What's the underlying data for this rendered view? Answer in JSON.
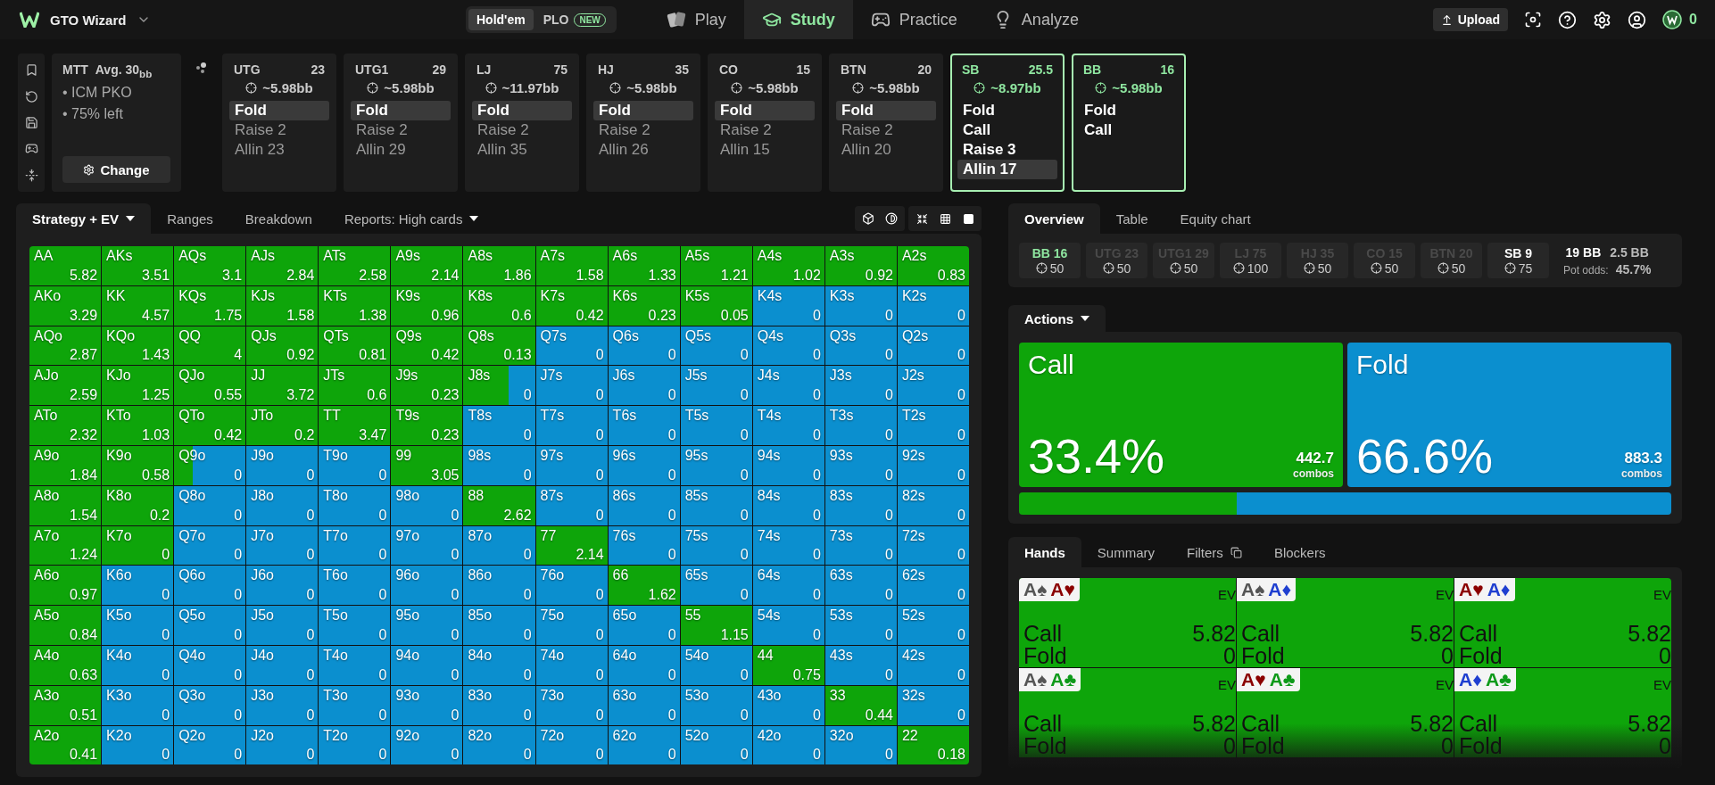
{
  "app": {
    "name": "GTO Wizard"
  },
  "modes": [
    {
      "label": "Hold'em",
      "selected": true
    },
    {
      "label": "PLO",
      "selected": false,
      "badge": "NEW"
    }
  ],
  "nav": [
    {
      "label": "Play",
      "selected": false
    },
    {
      "label": "Study",
      "selected": true
    },
    {
      "label": "Practice",
      "selected": false
    },
    {
      "label": "Analyze",
      "selected": false
    }
  ],
  "upload": {
    "label": "Upload"
  },
  "coins": "0",
  "spot": {
    "format": "MTT",
    "stack": "Avg. 30$_{bb}$",
    "details": [
      "• ICM PKO",
      "• 75% left"
    ],
    "button": "Change"
  },
  "positions": [
    {
      "name": "UTG",
      "stack": "23",
      "to_call": "~5.98bb",
      "active": false,
      "actions": [
        {
          "label": "Fold",
          "selected": true
        },
        {
          "label": "Raise 2",
          "selected": false
        },
        {
          "label": "Allin 23",
          "selected": false
        }
      ]
    },
    {
      "name": "UTG1",
      "stack": "29",
      "to_call": "~5.98bb",
      "active": false,
      "actions": [
        {
          "label": "Fold",
          "selected": true
        },
        {
          "label": "Raise 2",
          "selected": false
        },
        {
          "label": "Allin 29",
          "selected": false
        }
      ]
    },
    {
      "name": "LJ",
      "stack": "75",
      "to_call": "~11.97bb",
      "active": false,
      "actions": [
        {
          "label": "Fold",
          "selected": true
        },
        {
          "label": "Raise 2",
          "selected": false
        },
        {
          "label": "Allin 35",
          "selected": false
        }
      ]
    },
    {
      "name": "HJ",
      "stack": "35",
      "to_call": "~5.98bb",
      "active": false,
      "actions": [
        {
          "label": "Fold",
          "selected": true
        },
        {
          "label": "Raise 2",
          "selected": false
        },
        {
          "label": "Allin 26",
          "selected": false
        }
      ]
    },
    {
      "name": "CO",
      "stack": "15",
      "to_call": "~5.98bb",
      "active": false,
      "actions": [
        {
          "label": "Fold",
          "selected": true
        },
        {
          "label": "Raise 2",
          "selected": false
        },
        {
          "label": "Allin 15",
          "selected": false
        }
      ]
    },
    {
      "name": "BTN",
      "stack": "20",
      "to_call": "~5.98bb",
      "active": false,
      "actions": [
        {
          "label": "Fold",
          "selected": true
        },
        {
          "label": "Raise 2",
          "selected": false
        },
        {
          "label": "Allin 20",
          "selected": false
        }
      ]
    },
    {
      "name": "SB",
      "stack": "25.5",
      "to_call": "~8.97bb",
      "active": true,
      "actions": [
        {
          "label": "Fold",
          "selected": false
        },
        {
          "label": "Call",
          "selected": false
        },
        {
          "label": "Raise 3",
          "selected": false
        },
        {
          "label": "Allin 17",
          "selected": true
        }
      ]
    },
    {
      "name": "BB",
      "stack": "16",
      "to_call": "~5.98bb",
      "active": true,
      "actions": [
        {
          "label": "Fold",
          "selected": false
        },
        {
          "label": "Call",
          "selected": false
        }
      ]
    }
  ],
  "matrix_tabs": [
    {
      "label": "Strategy + EV",
      "selected": true,
      "dropdown": true
    },
    {
      "label": "Ranges",
      "selected": false,
      "dropdown": false
    },
    {
      "label": "Breakdown",
      "selected": false,
      "dropdown": false
    },
    {
      "label": "Reports: High cards",
      "selected": false,
      "dropdown": true
    }
  ],
  "matrix": [
    [
      {
        "hand": "AA",
        "ev": "5.82",
        "kind": "call"
      },
      {
        "hand": "AKs",
        "ev": "3.51",
        "kind": "call"
      },
      {
        "hand": "AQs",
        "ev": "3.1",
        "kind": "call"
      },
      {
        "hand": "AJs",
        "ev": "2.84",
        "kind": "call"
      },
      {
        "hand": "ATs",
        "ev": "2.58",
        "kind": "call"
      },
      {
        "hand": "A9s",
        "ev": "2.14",
        "kind": "call"
      },
      {
        "hand": "A8s",
        "ev": "1.86",
        "kind": "call"
      },
      {
        "hand": "A7s",
        "ev": "1.58",
        "kind": "call"
      },
      {
        "hand": "A6s",
        "ev": "1.33",
        "kind": "call"
      },
      {
        "hand": "A5s",
        "ev": "1.21",
        "kind": "call"
      },
      {
        "hand": "A4s",
        "ev": "1.02",
        "kind": "call"
      },
      {
        "hand": "A3s",
        "ev": "0.92",
        "kind": "call"
      },
      {
        "hand": "A2s",
        "ev": "0.83",
        "kind": "call"
      }
    ],
    [
      {
        "hand": "AKo",
        "ev": "3.29",
        "kind": "call"
      },
      {
        "hand": "KK",
        "ev": "4.57",
        "kind": "call"
      },
      {
        "hand": "KQs",
        "ev": "1.75",
        "kind": "call"
      },
      {
        "hand": "KJs",
        "ev": "1.58",
        "kind": "call"
      },
      {
        "hand": "KTs",
        "ev": "1.38",
        "kind": "call"
      },
      {
        "hand": "K9s",
        "ev": "0.96",
        "kind": "call"
      },
      {
        "hand": "K8s",
        "ev": "0.6",
        "kind": "call"
      },
      {
        "hand": "K7s",
        "ev": "0.42",
        "kind": "call"
      },
      {
        "hand": "K6s",
        "ev": "0.23",
        "kind": "call"
      },
      {
        "hand": "K5s",
        "ev": "0.05",
        "kind": "call"
      },
      {
        "hand": "K4s",
        "ev": "0",
        "kind": "fold"
      },
      {
        "hand": "K3s",
        "ev": "0",
        "kind": "fold"
      },
      {
        "hand": "K2s",
        "ev": "0",
        "kind": "fold"
      }
    ],
    [
      {
        "hand": "AQo",
        "ev": "2.87",
        "kind": "call"
      },
      {
        "hand": "KQo",
        "ev": "1.43",
        "kind": "call"
      },
      {
        "hand": "QQ",
        "ev": "4",
        "kind": "call"
      },
      {
        "hand": "QJs",
        "ev": "0.92",
        "kind": "call"
      },
      {
        "hand": "QTs",
        "ev": "0.81",
        "kind": "call"
      },
      {
        "hand": "Q9s",
        "ev": "0.42",
        "kind": "call"
      },
      {
        "hand": "Q8s",
        "ev": "0.13",
        "kind": "call"
      },
      {
        "hand": "Q7s",
        "ev": "0",
        "kind": "fold"
      },
      {
        "hand": "Q6s",
        "ev": "0",
        "kind": "fold"
      },
      {
        "hand": "Q5s",
        "ev": "0",
        "kind": "fold"
      },
      {
        "hand": "Q4s",
        "ev": "0",
        "kind": "fold"
      },
      {
        "hand": "Q3s",
        "ev": "0",
        "kind": "fold"
      },
      {
        "hand": "Q2s",
        "ev": "0",
        "kind": "fold"
      }
    ],
    [
      {
        "hand": "AJo",
        "ev": "2.59",
        "kind": "call"
      },
      {
        "hand": "KJo",
        "ev": "1.25",
        "kind": "call"
      },
      {
        "hand": "QJo",
        "ev": "0.55",
        "kind": "call"
      },
      {
        "hand": "JJ",
        "ev": "3.72",
        "kind": "call"
      },
      {
        "hand": "JTs",
        "ev": "0.6",
        "kind": "call"
      },
      {
        "hand": "J9s",
        "ev": "0.23",
        "kind": "call"
      },
      {
        "hand": "J8s",
        "ev": "0",
        "kind": "mixed",
        "level": 0.63
      },
      {
        "hand": "J7s",
        "ev": "0",
        "kind": "fold"
      },
      {
        "hand": "J6s",
        "ev": "0",
        "kind": "fold"
      },
      {
        "hand": "J5s",
        "ev": "0",
        "kind": "fold"
      },
      {
        "hand": "J4s",
        "ev": "0",
        "kind": "fold"
      },
      {
        "hand": "J3s",
        "ev": "0",
        "kind": "fold"
      },
      {
        "hand": "J2s",
        "ev": "0",
        "kind": "fold"
      }
    ],
    [
      {
        "hand": "ATo",
        "ev": "2.32",
        "kind": "call"
      },
      {
        "hand": "KTo",
        "ev": "1.03",
        "kind": "call"
      },
      {
        "hand": "QTo",
        "ev": "0.42",
        "kind": "call"
      },
      {
        "hand": "JTo",
        "ev": "0.2",
        "kind": "call"
      },
      {
        "hand": "TT",
        "ev": "3.47",
        "kind": "call"
      },
      {
        "hand": "T9s",
        "ev": "0.23",
        "kind": "call"
      },
      {
        "hand": "T8s",
        "ev": "0",
        "kind": "fold"
      },
      {
        "hand": "T7s",
        "ev": "0",
        "kind": "fold"
      },
      {
        "hand": "T6s",
        "ev": "0",
        "kind": "fold"
      },
      {
        "hand": "T5s",
        "ev": "0",
        "kind": "fold"
      },
      {
        "hand": "T4s",
        "ev": "0",
        "kind": "fold"
      },
      {
        "hand": "T3s",
        "ev": "0",
        "kind": "fold"
      },
      {
        "hand": "T2s",
        "ev": "0",
        "kind": "fold"
      }
    ],
    [
      {
        "hand": "A9o",
        "ev": "1.84",
        "kind": "call"
      },
      {
        "hand": "K9o",
        "ev": "0.58",
        "kind": "call"
      },
      {
        "hand": "Q9o",
        "ev": "0",
        "kind": "mixed",
        "level": 0.26
      },
      {
        "hand": "J9o",
        "ev": "0",
        "kind": "fold"
      },
      {
        "hand": "T9o",
        "ev": "0",
        "kind": "fold"
      },
      {
        "hand": "99",
        "ev": "3.05",
        "kind": "call"
      },
      {
        "hand": "98s",
        "ev": "0",
        "kind": "fold"
      },
      {
        "hand": "97s",
        "ev": "0",
        "kind": "fold"
      },
      {
        "hand": "96s",
        "ev": "0",
        "kind": "fold"
      },
      {
        "hand": "95s",
        "ev": "0",
        "kind": "fold"
      },
      {
        "hand": "94s",
        "ev": "0",
        "kind": "fold"
      },
      {
        "hand": "93s",
        "ev": "0",
        "kind": "fold"
      },
      {
        "hand": "92s",
        "ev": "0",
        "kind": "fold"
      }
    ],
    [
      {
        "hand": "A8o",
        "ev": "1.54",
        "kind": "call"
      },
      {
        "hand": "K8o",
        "ev": "0.2",
        "kind": "call"
      },
      {
        "hand": "Q8o",
        "ev": "0",
        "kind": "fold"
      },
      {
        "hand": "J8o",
        "ev": "0",
        "kind": "fold"
      },
      {
        "hand": "T8o",
        "ev": "0",
        "kind": "fold"
      },
      {
        "hand": "98o",
        "ev": "0",
        "kind": "fold"
      },
      {
        "hand": "88",
        "ev": "2.62",
        "kind": "call"
      },
      {
        "hand": "87s",
        "ev": "0",
        "kind": "fold"
      },
      {
        "hand": "86s",
        "ev": "0",
        "kind": "fold"
      },
      {
        "hand": "85s",
        "ev": "0",
        "kind": "fold"
      },
      {
        "hand": "84s",
        "ev": "0",
        "kind": "fold"
      },
      {
        "hand": "83s",
        "ev": "0",
        "kind": "fold"
      },
      {
        "hand": "82s",
        "ev": "0",
        "kind": "fold"
      }
    ],
    [
      {
        "hand": "A7o",
        "ev": "1.24",
        "kind": "call"
      },
      {
        "hand": "K7o",
        "ev": "0",
        "kind": "call"
      },
      {
        "hand": "Q7o",
        "ev": "0",
        "kind": "fold"
      },
      {
        "hand": "J7o",
        "ev": "0",
        "kind": "fold"
      },
      {
        "hand": "T7o",
        "ev": "0",
        "kind": "fold"
      },
      {
        "hand": "97o",
        "ev": "0",
        "kind": "fold"
      },
      {
        "hand": "87o",
        "ev": "0",
        "kind": "fold"
      },
      {
        "hand": "77",
        "ev": "2.14",
        "kind": "call"
      },
      {
        "hand": "76s",
        "ev": "0",
        "kind": "fold"
      },
      {
        "hand": "75s",
        "ev": "0",
        "kind": "fold"
      },
      {
        "hand": "74s",
        "ev": "0",
        "kind": "fold"
      },
      {
        "hand": "73s",
        "ev": "0",
        "kind": "fold"
      },
      {
        "hand": "72s",
        "ev": "0",
        "kind": "fold"
      }
    ],
    [
      {
        "hand": "A6o",
        "ev": "0.97",
        "kind": "call"
      },
      {
        "hand": "K6o",
        "ev": "0",
        "kind": "fold"
      },
      {
        "hand": "Q6o",
        "ev": "0",
        "kind": "fold"
      },
      {
        "hand": "J6o",
        "ev": "0",
        "kind": "fold"
      },
      {
        "hand": "T6o",
        "ev": "0",
        "kind": "fold"
      },
      {
        "hand": "96o",
        "ev": "0",
        "kind": "fold"
      },
      {
        "hand": "86o",
        "ev": "0",
        "kind": "fold"
      },
      {
        "hand": "76o",
        "ev": "0",
        "kind": "fold"
      },
      {
        "hand": "66",
        "ev": "1.62",
        "kind": "call"
      },
      {
        "hand": "65s",
        "ev": "0",
        "kind": "fold"
      },
      {
        "hand": "64s",
        "ev": "0",
        "kind": "fold"
      },
      {
        "hand": "63s",
        "ev": "0",
        "kind": "fold"
      },
      {
        "hand": "62s",
        "ev": "0",
        "kind": "fold"
      }
    ],
    [
      {
        "hand": "A5o",
        "ev": "0.84",
        "kind": "call"
      },
      {
        "hand": "K5o",
        "ev": "0",
        "kind": "fold"
      },
      {
        "hand": "Q5o",
        "ev": "0",
        "kind": "fold"
      },
      {
        "hand": "J5o",
        "ev": "0",
        "kind": "fold"
      },
      {
        "hand": "T5o",
        "ev": "0",
        "kind": "fold"
      },
      {
        "hand": "95o",
        "ev": "0",
        "kind": "fold"
      },
      {
        "hand": "85o",
        "ev": "0",
        "kind": "fold"
      },
      {
        "hand": "75o",
        "ev": "0",
        "kind": "fold"
      },
      {
        "hand": "65o",
        "ev": "0",
        "kind": "fold"
      },
      {
        "hand": "55",
        "ev": "1.15",
        "kind": "call"
      },
      {
        "hand": "54s",
        "ev": "0",
        "kind": "fold"
      },
      {
        "hand": "53s",
        "ev": "0",
        "kind": "fold"
      },
      {
        "hand": "52s",
        "ev": "0",
        "kind": "fold"
      }
    ],
    [
      {
        "hand": "A4o",
        "ev": "0.63",
        "kind": "call"
      },
      {
        "hand": "K4o",
        "ev": "0",
        "kind": "fold"
      },
      {
        "hand": "Q4o",
        "ev": "0",
        "kind": "fold"
      },
      {
        "hand": "J4o",
        "ev": "0",
        "kind": "fold"
      },
      {
        "hand": "T4o",
        "ev": "0",
        "kind": "fold"
      },
      {
        "hand": "94o",
        "ev": "0",
        "kind": "fold"
      },
      {
        "hand": "84o",
        "ev": "0",
        "kind": "fold"
      },
      {
        "hand": "74o",
        "ev": "0",
        "kind": "fold"
      },
      {
        "hand": "64o",
        "ev": "0",
        "kind": "fold"
      },
      {
        "hand": "54o",
        "ev": "0",
        "kind": "fold"
      },
      {
        "hand": "44",
        "ev": "0.75",
        "kind": "call"
      },
      {
        "hand": "43s",
        "ev": "0",
        "kind": "fold"
      },
      {
        "hand": "42s",
        "ev": "0",
        "kind": "fold"
      }
    ],
    [
      {
        "hand": "A3o",
        "ev": "0.51",
        "kind": "call"
      },
      {
        "hand": "K3o",
        "ev": "0",
        "kind": "fold"
      },
      {
        "hand": "Q3o",
        "ev": "0",
        "kind": "fold"
      },
      {
        "hand": "J3o",
        "ev": "0",
        "kind": "fold"
      },
      {
        "hand": "T3o",
        "ev": "0",
        "kind": "fold"
      },
      {
        "hand": "93o",
        "ev": "0",
        "kind": "fold"
      },
      {
        "hand": "83o",
        "ev": "0",
        "kind": "fold"
      },
      {
        "hand": "73o",
        "ev": "0",
        "kind": "fold"
      },
      {
        "hand": "63o",
        "ev": "0",
        "kind": "fold"
      },
      {
        "hand": "53o",
        "ev": "0",
        "kind": "fold"
      },
      {
        "hand": "43o",
        "ev": "0",
        "kind": "fold"
      },
      {
        "hand": "33",
        "ev": "0.44",
        "kind": "call"
      },
      {
        "hand": "32s",
        "ev": "0",
        "kind": "fold"
      }
    ],
    [
      {
        "hand": "A2o",
        "ev": "0.41",
        "kind": "call"
      },
      {
        "hand": "K2o",
        "ev": "0",
        "kind": "fold"
      },
      {
        "hand": "Q2o",
        "ev": "0",
        "kind": "fold"
      },
      {
        "hand": "J2o",
        "ev": "0",
        "kind": "fold"
      },
      {
        "hand": "T2o",
        "ev": "0",
        "kind": "fold"
      },
      {
        "hand": "92o",
        "ev": "0",
        "kind": "fold"
      },
      {
        "hand": "82o",
        "ev": "0",
        "kind": "fold"
      },
      {
        "hand": "72o",
        "ev": "0",
        "kind": "fold"
      },
      {
        "hand": "62o",
        "ev": "0",
        "kind": "fold"
      },
      {
        "hand": "52o",
        "ev": "0",
        "kind": "fold"
      },
      {
        "hand": "42o",
        "ev": "0",
        "kind": "fold"
      },
      {
        "hand": "32o",
        "ev": "0",
        "kind": "fold"
      },
      {
        "hand": "22",
        "ev": "0.18",
        "kind": "call"
      }
    ]
  ],
  "overview_tabs": [
    {
      "label": "Overview",
      "selected": true
    },
    {
      "label": "Table",
      "selected": false
    },
    {
      "label": "Equity chart",
      "selected": false
    }
  ],
  "seats": [
    {
      "label": "BB 16",
      "value": "50",
      "folded": false,
      "hero": true
    },
    {
      "label": "UTG 23",
      "value": "50",
      "folded": true,
      "hero": false
    },
    {
      "label": "UTG1 29",
      "value": "50",
      "folded": true,
      "hero": false
    },
    {
      "label": "LJ 75",
      "value": "100",
      "folded": true,
      "hero": false
    },
    {
      "label": "HJ 35",
      "value": "50",
      "folded": true,
      "hero": false
    },
    {
      "label": "CO 15",
      "value": "50",
      "folded": true,
      "hero": false
    },
    {
      "label": "BTN 20",
      "value": "50",
      "folded": true,
      "hero": false
    },
    {
      "label": "SB 9",
      "value": "75",
      "folded": false,
      "hero": false
    }
  ],
  "pot": {
    "total": "19 BB",
    "to_call": "2.5 BB",
    "odds_label": "Pot odds:",
    "odds": "45.7%"
  },
  "actions_tab": {
    "label": "Actions"
  },
  "actions": [
    {
      "name": "Call",
      "percent": "33.4%",
      "combos": "442.7",
      "unit": "combos",
      "color": "#0ea50a",
      "level": 0.334
    },
    {
      "name": "Fold",
      "percent": "66.6%",
      "combos": "883.3",
      "unit": "combos",
      "color": "#0b8fcf",
      "level": 0.666
    }
  ],
  "hands_tabs": [
    {
      "label": "Hands",
      "selected": true,
      "icon": false
    },
    {
      "label": "Summary",
      "selected": false,
      "icon": false
    },
    {
      "label": "Filters",
      "selected": false,
      "icon": true
    },
    {
      "label": "Blockers",
      "selected": false,
      "icon": false
    }
  ],
  "hands": [
    {
      "cards": [
        {
          "rank": "A",
          "suit": "♠",
          "color": "#555555"
        },
        {
          "rank": "A",
          "suit": "♥",
          "color": "#8b0000"
        }
      ],
      "ev_label": "EV",
      "rows": [
        {
          "action": "Call",
          "ev": "5.82"
        },
        {
          "action": "Fold",
          "ev": "0"
        }
      ]
    },
    {
      "cards": [
        {
          "rank": "A",
          "suit": "♠",
          "color": "#555555"
        },
        {
          "rank": "A",
          "suit": "♦",
          "color": "#1f3fd0"
        }
      ],
      "ev_label": "EV",
      "rows": [
        {
          "action": "Call",
          "ev": "5.82"
        },
        {
          "action": "Fold",
          "ev": "0"
        }
      ]
    },
    {
      "cards": [
        {
          "rank": "A",
          "suit": "♥",
          "color": "#8b0000"
        },
        {
          "rank": "A",
          "suit": "♦",
          "color": "#1f3fd0"
        }
      ],
      "ev_label": "EV",
      "rows": [
        {
          "action": "Call",
          "ev": "5.82"
        },
        {
          "action": "Fold",
          "ev": "0"
        }
      ]
    },
    {
      "cards": [
        {
          "rank": "A",
          "suit": "♠",
          "color": "#555555"
        },
        {
          "rank": "A",
          "suit": "♣",
          "color": "#0e9a1a"
        }
      ],
      "ev_label": "EV",
      "rows": [
        {
          "action": "Call",
          "ev": "5.82"
        },
        {
          "action": "Fold",
          "ev": "0"
        }
      ]
    },
    {
      "cards": [
        {
          "rank": "A",
          "suit": "♥",
          "color": "#8b0000"
        },
        {
          "rank": "A",
          "suit": "♣",
          "color": "#0e9a1a"
        }
      ],
      "ev_label": "EV",
      "rows": [
        {
          "action": "Call",
          "ev": "5.82"
        },
        {
          "action": "Fold",
          "ev": "0"
        }
      ]
    },
    {
      "cards": [
        {
          "rank": "A",
          "suit": "♦",
          "color": "#1f3fd0"
        },
        {
          "rank": "A",
          "suit": "♣",
          "color": "#0e9a1a"
        }
      ],
      "ev_label": "EV",
      "rows": [
        {
          "action": "Call",
          "ev": "5.82"
        },
        {
          "action": "Fold",
          "ev": "0"
        }
      ]
    }
  ]
}
